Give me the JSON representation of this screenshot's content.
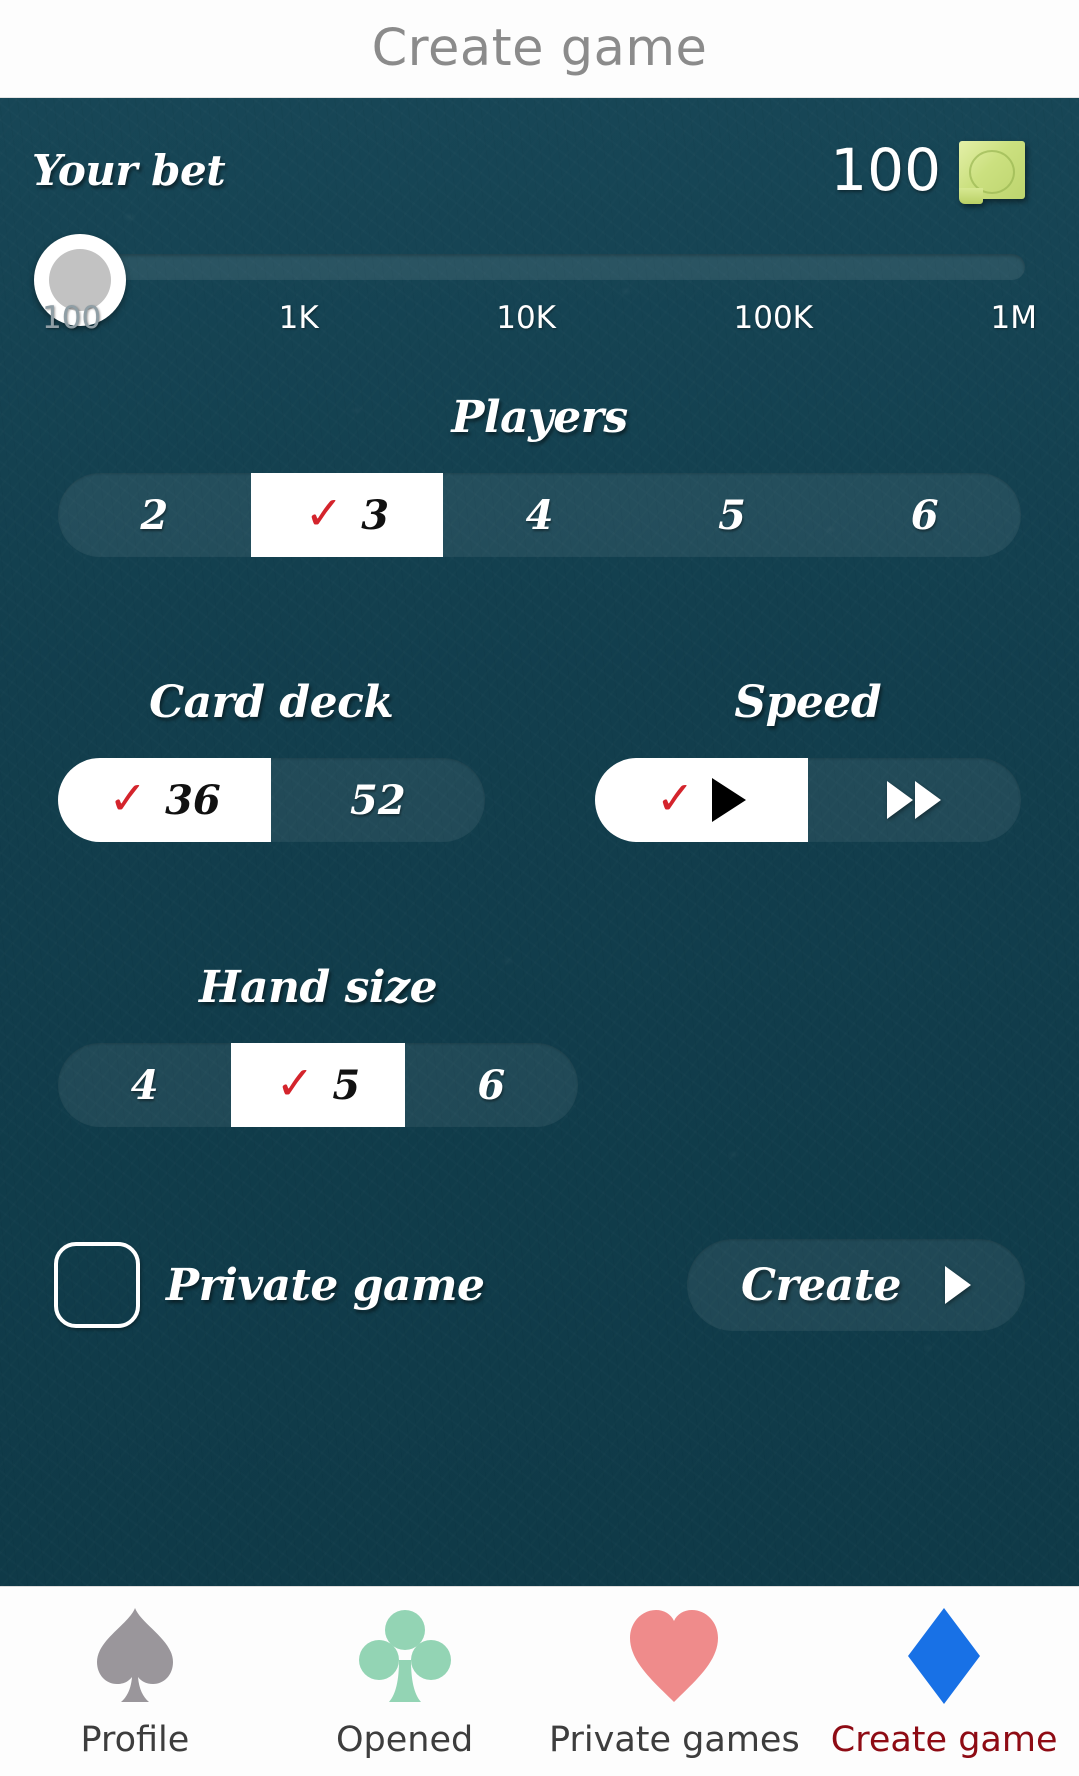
{
  "header": {
    "title": "Create game"
  },
  "bet": {
    "label": "Your bet",
    "amount": "100",
    "money_icon": "money-bill-icon",
    "slider": {
      "value": "100",
      "min": 100,
      "max": 1000000,
      "position_percent": 0,
      "ticks": [
        {
          "label": "100",
          "dim": true
        },
        {
          "label": "1K",
          "dim": false
        },
        {
          "label": "10K",
          "dim": false
        },
        {
          "label": "100K",
          "dim": false
        },
        {
          "label": "1M",
          "dim": false
        }
      ]
    }
  },
  "players": {
    "title": "Players",
    "selected": "3",
    "options": [
      {
        "label": "2",
        "selected": false
      },
      {
        "label": "3",
        "selected": true
      },
      {
        "label": "4",
        "selected": false
      },
      {
        "label": "5",
        "selected": false
      },
      {
        "label": "6",
        "selected": false
      }
    ]
  },
  "card_deck": {
    "title": "Card deck",
    "selected": "36",
    "options": [
      {
        "label": "36",
        "selected": true
      },
      {
        "label": "52",
        "selected": false
      }
    ]
  },
  "speed": {
    "title": "Speed",
    "selected": "normal",
    "options": [
      {
        "icon": "play-icon",
        "name": "normal",
        "selected": true
      },
      {
        "icon": "fast-forward-icon",
        "name": "fast",
        "selected": false
      }
    ]
  },
  "hand_size": {
    "title": "Hand size",
    "selected": "5",
    "options": [
      {
        "label": "4",
        "selected": false
      },
      {
        "label": "5",
        "selected": true
      },
      {
        "label": "6",
        "selected": false
      }
    ]
  },
  "private_game": {
    "label": "Private game",
    "checked": false
  },
  "create_button": {
    "label": "Create",
    "icon": "play-arrow-icon"
  },
  "tabbar": {
    "items": [
      {
        "label": "Profile",
        "icon": "spade-icon",
        "color": "#9a969b",
        "active": false
      },
      {
        "label": "Opened",
        "icon": "club-icon",
        "color": "#93d4b4",
        "active": false
      },
      {
        "label": "Private games",
        "icon": "heart-icon",
        "color": "#ef8b8b",
        "active": false
      },
      {
        "label": "Create game",
        "icon": "diamond-icon",
        "color": "#1871e6",
        "active": true
      }
    ]
  },
  "colors": {
    "board_bg": "#12404f",
    "title_text": "#8b8b8b",
    "accent_check": "#d4242c",
    "active_tab_text": "#8e0b14",
    "selected_pill_bg": "#ffffff"
  }
}
